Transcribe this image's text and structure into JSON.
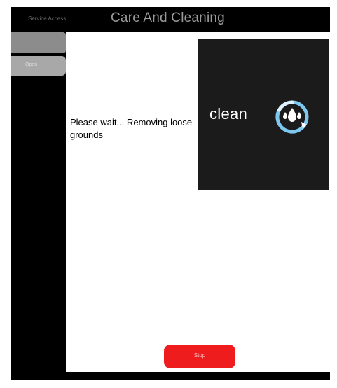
{
  "header": {
    "service_access": "Service Access",
    "title": "Care And Cleaning"
  },
  "sidebar": {
    "tabs": [
      {
        "label": ""
      },
      {
        "label": "Open"
      }
    ]
  },
  "main": {
    "status_text": "Please wait... Removing loose grounds",
    "panel": {
      "label": "clean",
      "icon": "clean-water-drops-icon"
    }
  },
  "footer": {
    "stop_label": "Stop"
  },
  "colors": {
    "screen_bg": "#000000",
    "content_bg": "#ffffff",
    "panel_bg": "#1b1b1b",
    "icon_ring": "#7ec8f0",
    "stop_button": "#ee1c1c"
  }
}
